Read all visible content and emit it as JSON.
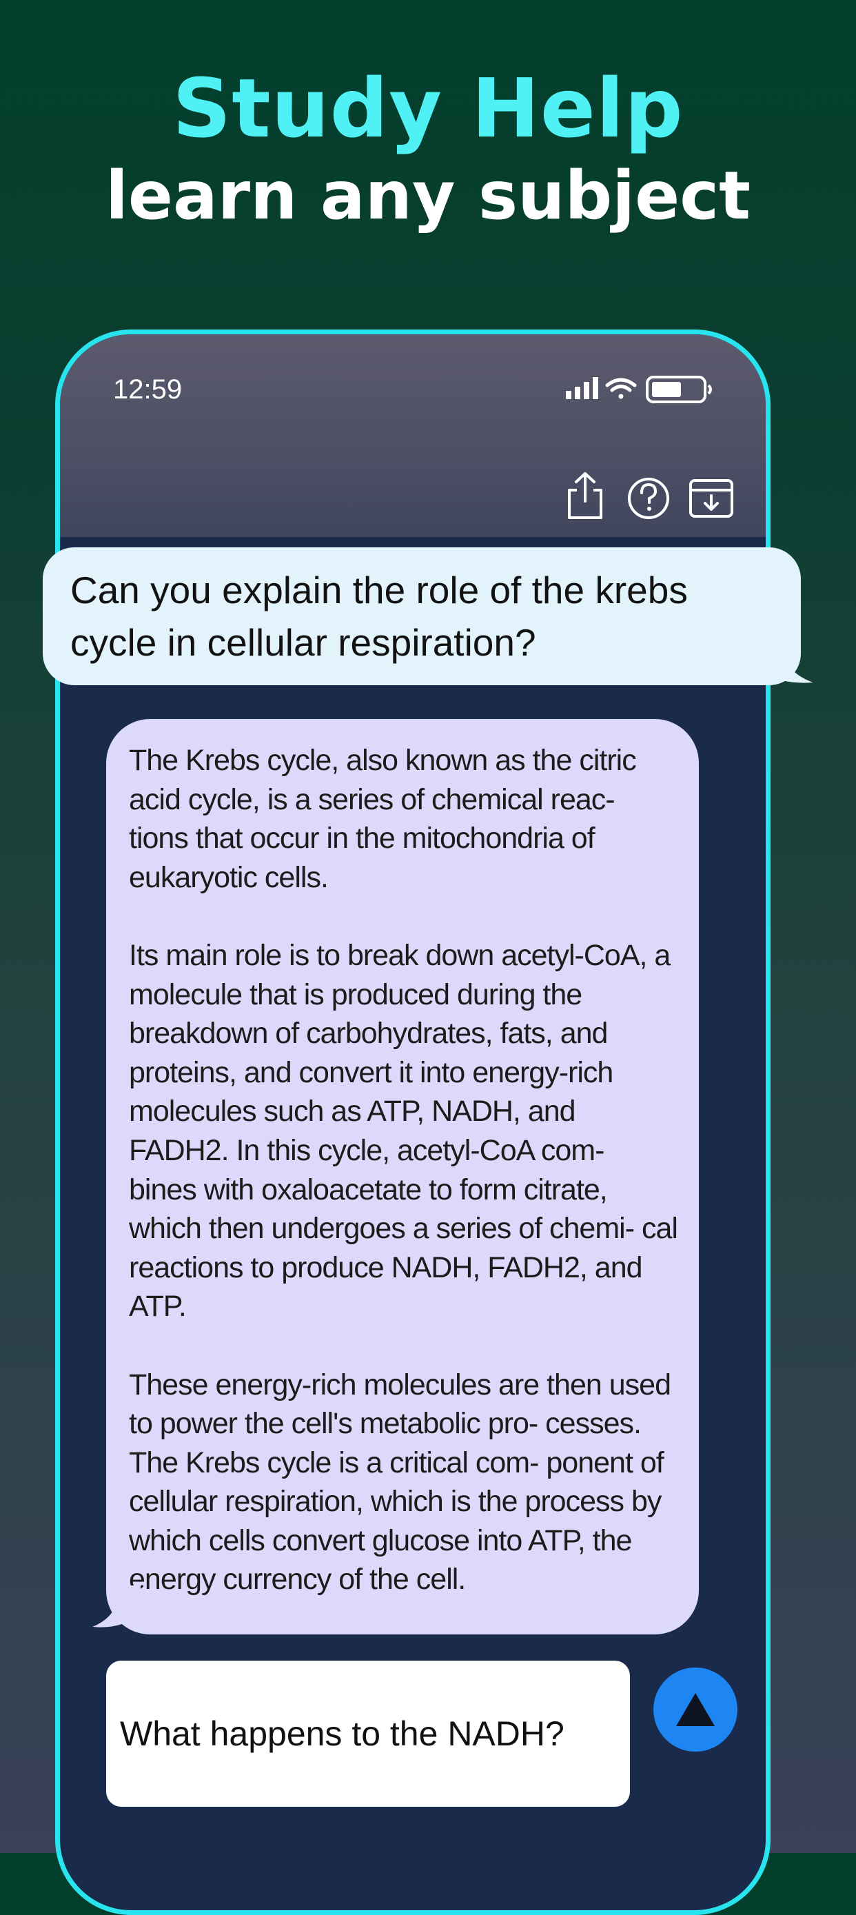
{
  "promo": {
    "title": "Study Help",
    "subtitle": "learn any subject"
  },
  "status_bar": {
    "time": "12:59",
    "icons": [
      "cellular-signal-icon",
      "wifi-icon",
      "battery-icon"
    ]
  },
  "header": {
    "actions": [
      "share-icon",
      "help-icon",
      "download-icon"
    ]
  },
  "chat": {
    "user_message": "Can you explain the role of the krebs cycle in cellular respiration?",
    "ai_response": [
      "The Krebs cycle, also known as the citric acid cycle, is a series of chemical reac- tions that occur in the mitochondria of eukaryotic cells.",
      "Its main role is to break down acetyl-CoA, a molecule that is produced during the breakdown of carbohydrates, fats, and proteins, and convert it into energy-rich molecules such as ATP, NADH, and FADH2. In this cycle, acetyl-CoA com- bines with oxaloacetate to form citrate, which then undergoes a series of chemi- cal reactions to produce NADH, FADH2, and ATP.",
      "These energy-rich molecules are then used to power the cell's metabolic pro- cesses. The Krebs cycle is a critical com- ponent of cellular respiration, which is the process by which cells convert glucose into ATP, the energy currency of the cell."
    ]
  },
  "composer": {
    "input_value": "What happens to the NADH?",
    "send_icon": "send-arrow-icon"
  },
  "colors": {
    "accent_cyan": "#4ff1f5",
    "phone_border": "#27e4ee",
    "user_bubble": "#e3f3fc",
    "ai_bubble": "#ddd9fb",
    "send_button": "#1d86f3"
  }
}
